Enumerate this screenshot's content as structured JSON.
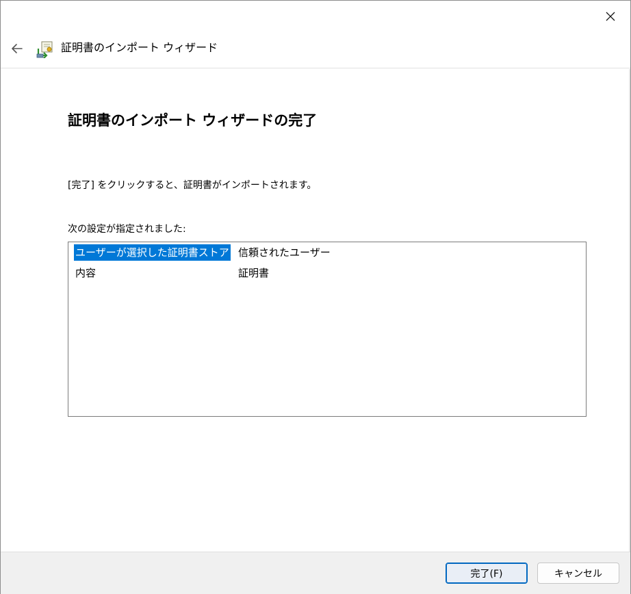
{
  "window": {
    "close_glyph": "✕"
  },
  "header": {
    "back_icon": "arrow-left-icon",
    "icon": "certificate-import-icon",
    "title": "証明書のインポート ウィザード"
  },
  "content": {
    "page_title": "証明書のインポート ウィザードの完了",
    "instruction": "[完了] をクリックすると、証明書がインポートされます。",
    "settings_label": "次の設定が指定されました:",
    "rows": [
      {
        "setting": "ユーザーが選択した証明書ストア",
        "value": "信頼されたユーザー",
        "selected": true
      },
      {
        "setting": "内容",
        "value": "証明書",
        "selected": false
      }
    ]
  },
  "footer": {
    "finish_label": "完了(F)",
    "cancel_label": "キャンセル"
  },
  "colors": {
    "selection": "#0078d7",
    "accent_border": "#0067c0"
  }
}
